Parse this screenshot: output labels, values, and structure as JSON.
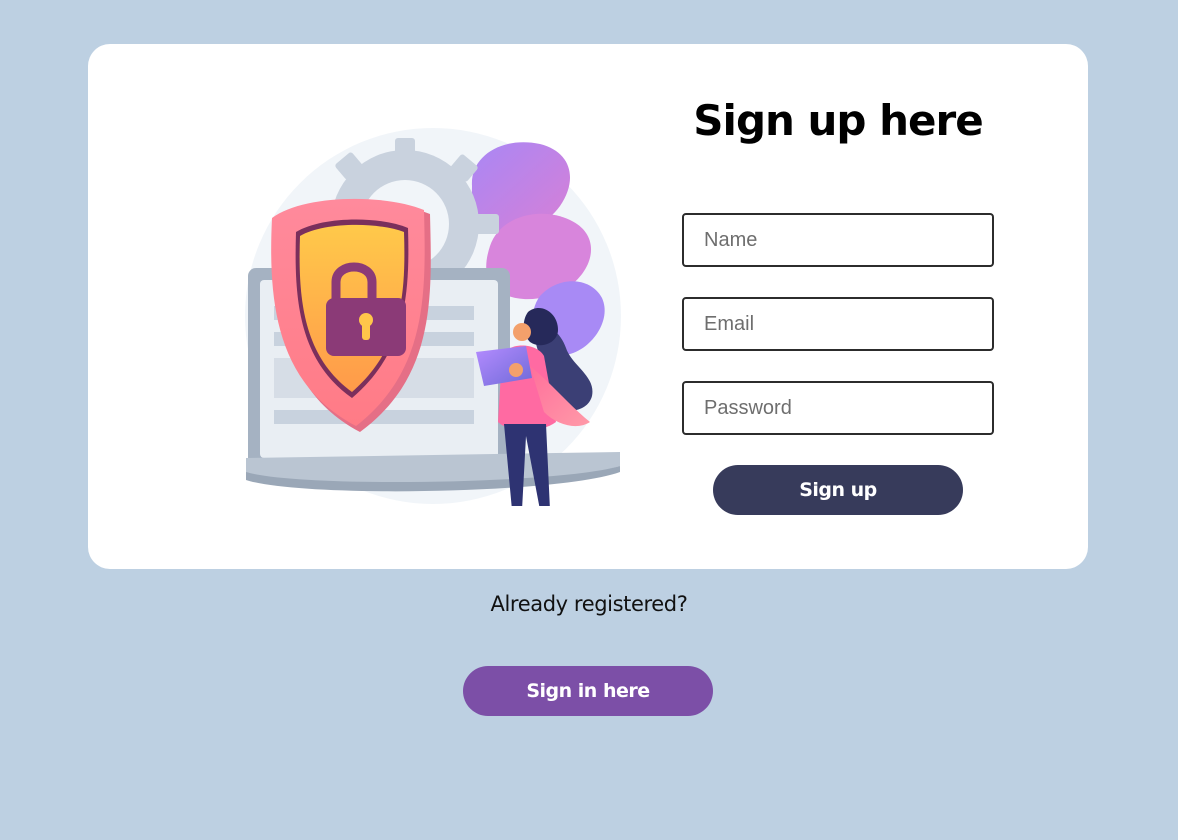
{
  "signup_form": {
    "title": "Sign up here",
    "name_placeholder": "Name",
    "email_placeholder": "Email",
    "password_placeholder": "Password",
    "submit_label": "Sign up"
  },
  "signin_prompt": {
    "text": "Already registered?",
    "button_label": "Sign in here"
  },
  "illustration": {
    "icon": "security-shield-lock-illustration"
  },
  "colors": {
    "page_background": "#bdd0e2",
    "card_background": "#ffffff",
    "signup_button": "#373b5b",
    "signin_button": "#7c4fa7"
  }
}
